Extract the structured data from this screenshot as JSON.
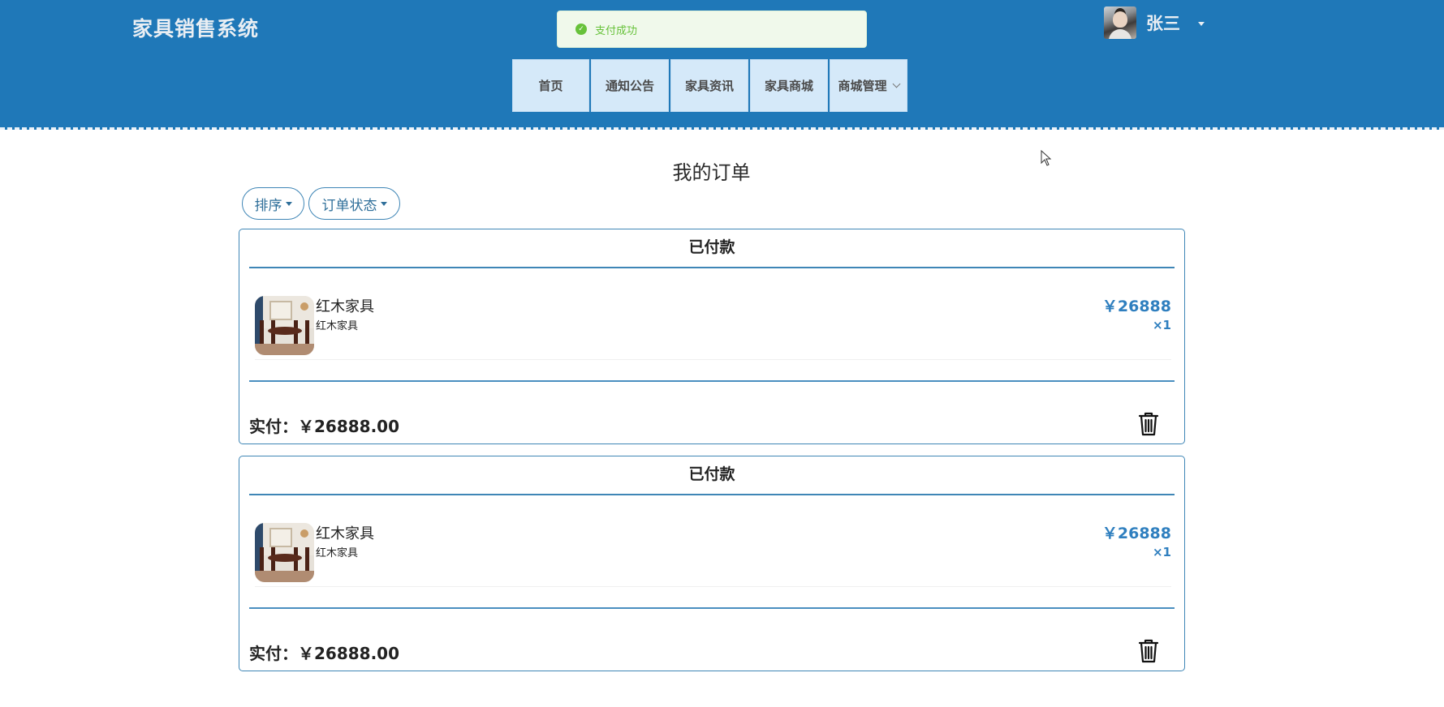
{
  "header": {
    "brand": "家具销售系统",
    "toast": "支付成功",
    "username": "张三",
    "nav": [
      {
        "label": "首页"
      },
      {
        "label": "通知公告"
      },
      {
        "label": "家具资讯"
      },
      {
        "label": "家具商城"
      },
      {
        "label": "商城管理"
      }
    ]
  },
  "main": {
    "title": "我的订单",
    "filters": {
      "sort": "排序",
      "status": "订单状态"
    },
    "orders": [
      {
        "status": "已付款",
        "item": {
          "name": "红木家具",
          "sub": "红木家具",
          "price": "￥26888",
          "qty": "×1"
        },
        "paid": "实付：￥26888.00"
      },
      {
        "status": "已付款",
        "item": {
          "name": "红木家具",
          "sub": "红木家具",
          "price": "￥26888",
          "qty": "×1"
        },
        "paid": "实付：￥26888.00"
      }
    ]
  },
  "colors": {
    "header_bg": "#1f78b8",
    "nav_bg": "#d5e9f9",
    "accent": "#3f86b6",
    "price": "#2f7fbf",
    "toast_text": "#67c23a"
  }
}
